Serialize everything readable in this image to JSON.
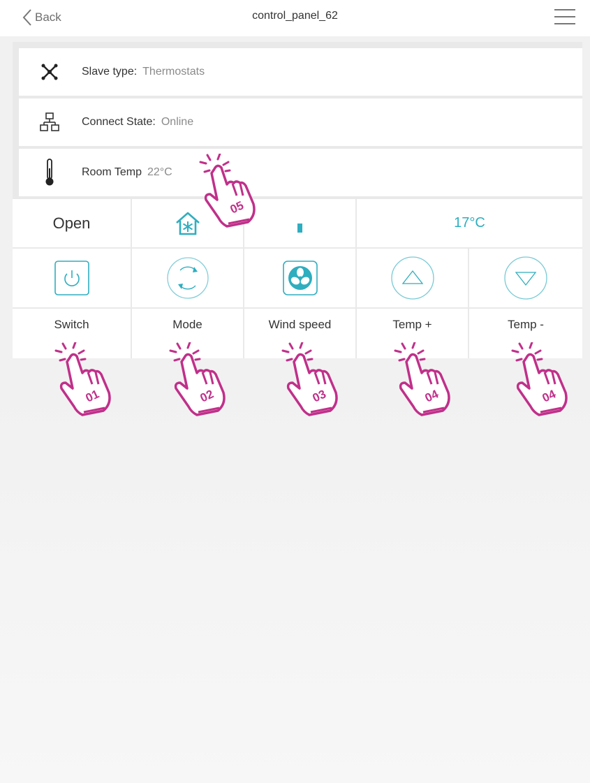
{
  "header": {
    "back_label": "Back",
    "title": "control_panel_62"
  },
  "info": {
    "slave_type_label": "Slave type:",
    "slave_type_value": "Thermostats",
    "connect_state_label": "Connect State:",
    "connect_state_value": "Online",
    "room_temp_label": "Room Temp",
    "room_temp_value": "22°C"
  },
  "status": {
    "power_state": "Open",
    "mode_icon": "house-snowflake-icon",
    "wind_level": "low",
    "set_temp": "17°C"
  },
  "controls": [
    {
      "label": "Switch",
      "icon": "power-icon"
    },
    {
      "label": "Mode",
      "icon": "cycle-icon"
    },
    {
      "label": "Wind speed",
      "icon": "fan-icon"
    },
    {
      "label": "Temp +",
      "icon": "triangle-up-icon"
    },
    {
      "label": "Temp -",
      "icon": "triangle-down-icon"
    }
  ],
  "annotations": [
    "01",
    "02",
    "03",
    "04",
    "04",
    "05"
  ],
  "colors": {
    "accent": "#2eaebf",
    "annotation": "#c0308a"
  }
}
